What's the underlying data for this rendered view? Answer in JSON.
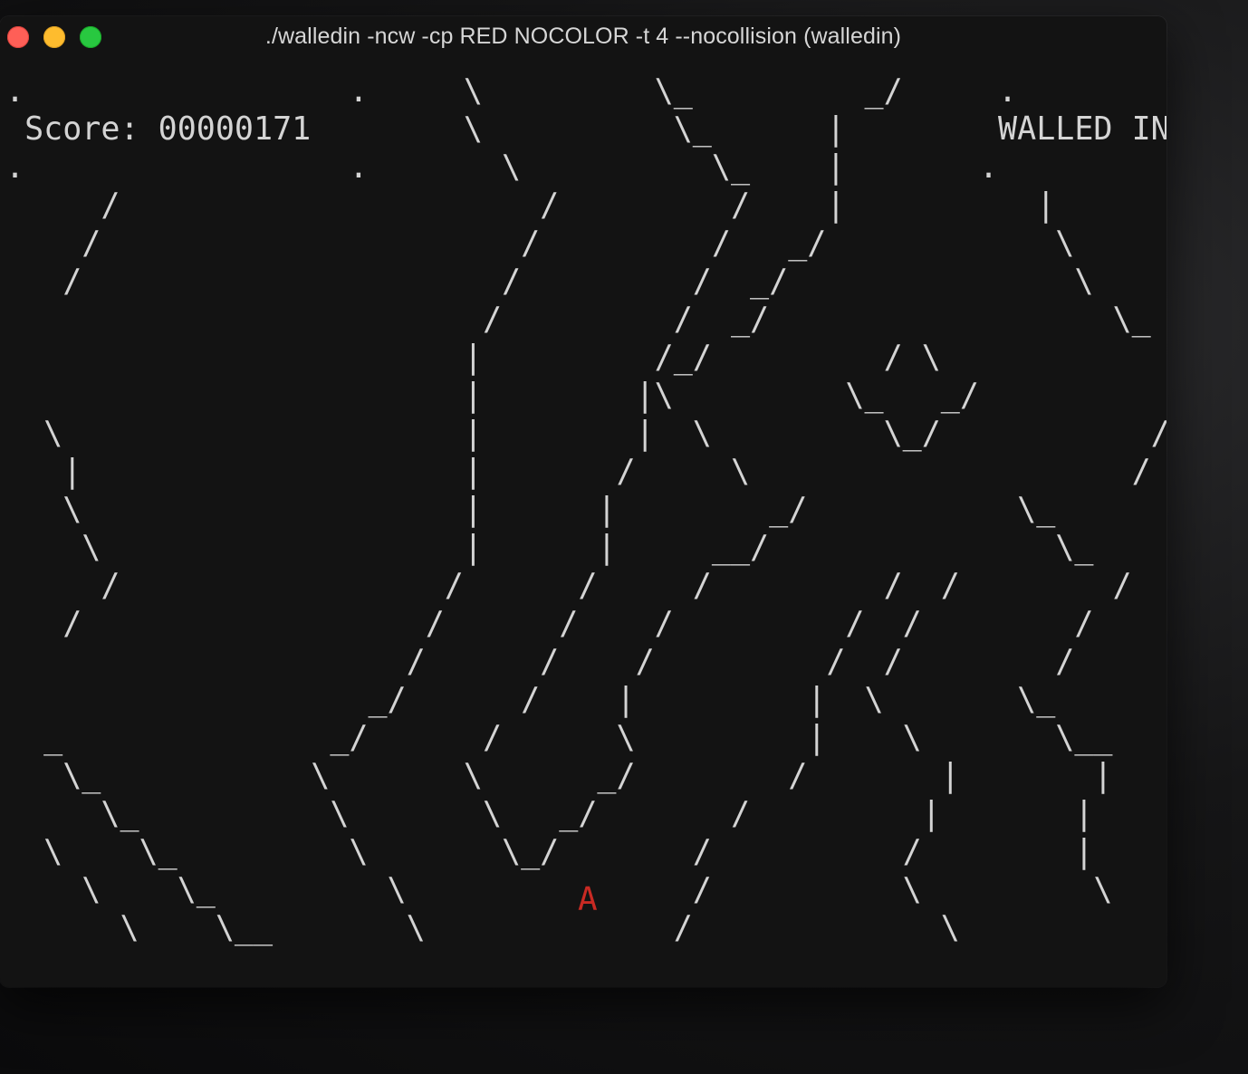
{
  "window": {
    "title": "./walledin -ncw -cp RED NOCOLOR -t 4 --nocollision (walledin)"
  },
  "game": {
    "score_label": "Score:",
    "score_value": "00000171",
    "game_title": "WALLED IN",
    "player_glyph": "A",
    "player_color": "#c92a23",
    "text_color": "#d4d4d4",
    "screen_lines": [
      ".                 .     \\         \\_         _/     .          .",
      " Score: 00000171        \\          \\_      |        WALLED IN",
      ".                 .       \\          \\_    |       .          .",
      "     /                      /         /    |          |",
      "    /                      /         /   _/            \\",
      "   /                      /         /  _/               \\",
      "                         /         /  _/                  \\_",
      "                        |         /_/         / \\            \\",
      "                        |        |\\         \\_   _/",
      "  \\                     |        |  \\         \\_/           /",
      "   |                    |       /     \\                    /",
      "   \\                    |      |        _/           \\_",
      "    \\                   |      |     __/               \\_",
      "     /                 /      /     /         /  /        /",
      "   /                  /      /    /         /  /        /",
      "                     /      /    /         /  /        /",
      "                   _/      /    |         |  \\       \\_",
      "  _              _/      /      \\         |    \\       \\__",
      "   \\_           \\       \\      _/        /       |       |",
      "     \\_          \\       \\   _/       /         |       |",
      "  \\    \\_         \\       \\_/       /          /        |",
      "    \\    \\_         \\               /          \\         \\",
      "      \\    \\__       \\             /             \\"
    ]
  }
}
